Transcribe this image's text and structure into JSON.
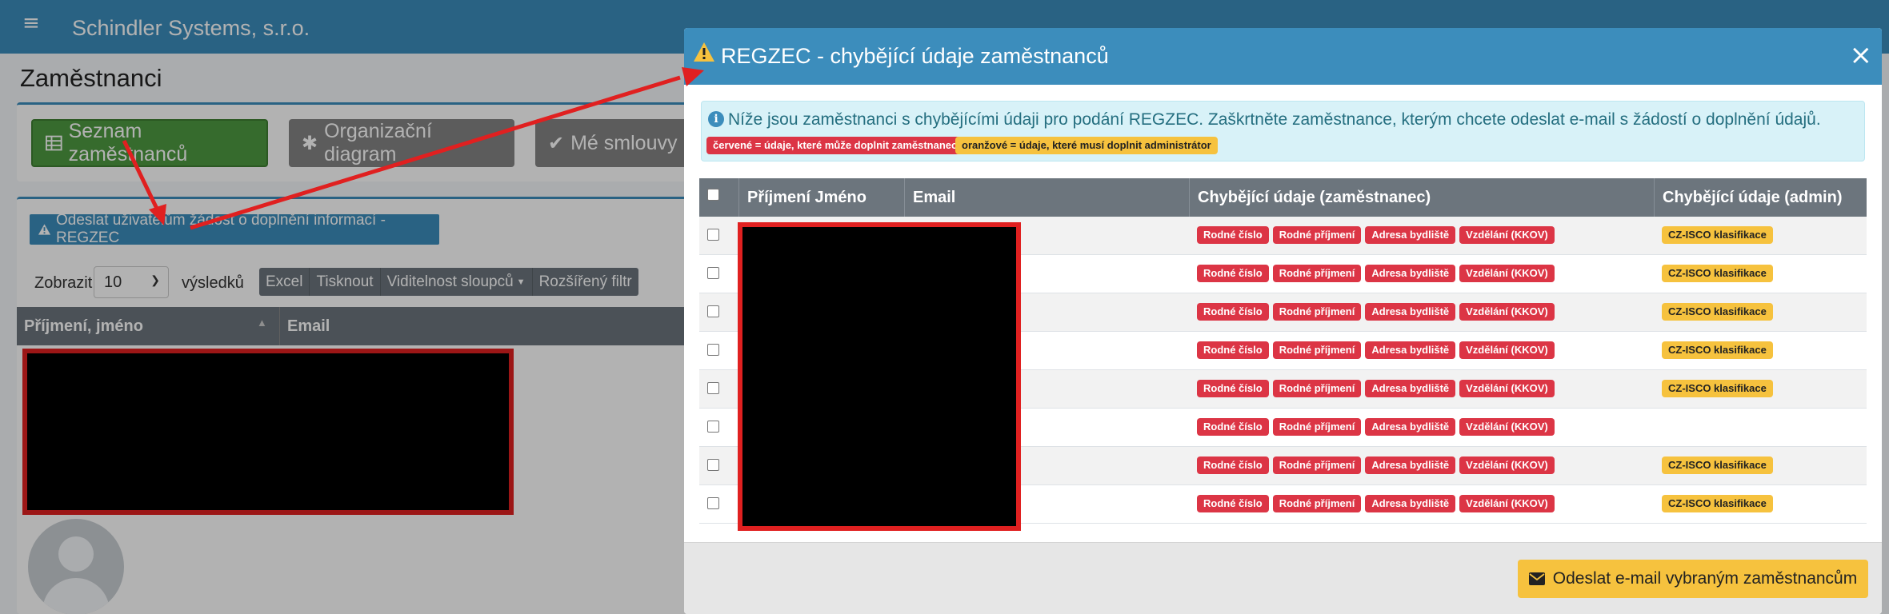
{
  "app": {
    "company_name": "Schindler Systems, s.r.o.",
    "page_title": "Zaměstnanci",
    "tabs": [
      {
        "label": "Seznam zaměstnanců",
        "icon": "table-icon",
        "active": true
      },
      {
        "label": "Organizační diagram",
        "icon": "asterisk-icon",
        "active": false
      },
      {
        "label": "Mé smlouvy",
        "icon": "check-icon",
        "active": false
      }
    ],
    "request_button_label": "Odeslat uživatelům žádost o doplnění informací - REGZEC",
    "show_label": "Zobrazit",
    "page_size": "10",
    "results_label": "výsledků",
    "table_buttons": [
      "Excel",
      "Tisknout",
      "Viditelnost sloupců",
      "Rozšířený filtr"
    ],
    "column_name": "Příjmení, jméno",
    "column_email": "Email"
  },
  "modal": {
    "title": "REGZEC - chybějící údaje zaměstnanců",
    "close_symbol": "×",
    "info_text": "Níže jsou zaměstnanci s chybějícími údaji pro podání REGZEC. Zaškrtněte zaměstnance, kterým chcete odeslat e-mail s žádostí o doplnění údajů.",
    "legend_red": "červené = údaje, které může doplnit zaměstnanec",
    "legend_orange": "oranžové = údaje, které musí doplnit administrátor",
    "columns": {
      "name": "Příjmení Jméno",
      "email": "Email",
      "missing_employee": "Chybějící údaje (zaměstnanec)",
      "missing_admin": "Chybějící údaje (admin)"
    },
    "rows": [
      {
        "employee": [
          "Rodné číslo",
          "Rodné příjmení",
          "Adresa bydliště",
          "Vzdělání (KKOV)"
        ],
        "admin": [
          "CZ-ISCO klasifikace"
        ]
      },
      {
        "employee": [
          "Rodné číslo",
          "Rodné příjmení",
          "Adresa bydliště",
          "Vzdělání (KKOV)"
        ],
        "admin": [
          "CZ-ISCO klasifikace"
        ]
      },
      {
        "employee": [
          "Rodné číslo",
          "Rodné příjmení",
          "Adresa bydliště",
          "Vzdělání (KKOV)"
        ],
        "admin": [
          "CZ-ISCO klasifikace"
        ]
      },
      {
        "employee": [
          "Rodné číslo",
          "Rodné příjmení",
          "Adresa bydliště",
          "Vzdělání (KKOV)"
        ],
        "admin": [
          "CZ-ISCO klasifikace"
        ]
      },
      {
        "employee": [
          "Rodné číslo",
          "Rodné příjmení",
          "Adresa bydliště",
          "Vzdělání (KKOV)"
        ],
        "admin": [
          "CZ-ISCO klasifikace"
        ]
      },
      {
        "employee": [
          "Rodné číslo",
          "Rodné příjmení",
          "Adresa bydliště",
          "Vzdělání (KKOV)"
        ],
        "admin": []
      },
      {
        "employee": [
          "Rodné číslo",
          "Rodné příjmení",
          "Adresa bydliště",
          "Vzdělání (KKOV)"
        ],
        "admin": [
          "CZ-ISCO klasifikace"
        ]
      },
      {
        "employee": [
          "Rodné číslo",
          "Rodné příjmení",
          "Adresa bydliště",
          "Vzdělání (KKOV)"
        ],
        "admin": [
          "CZ-ISCO klasifikace"
        ]
      }
    ],
    "send_button_label": "Odeslat e-mail vybraným zaměstnancům"
  },
  "colors": {
    "header_blue": "#3c8dbc",
    "badge_red": "#dc3545",
    "badge_orange": "#f6c23e",
    "active_tab_green": "#4e9a41",
    "annotation_red": "#e02020"
  }
}
